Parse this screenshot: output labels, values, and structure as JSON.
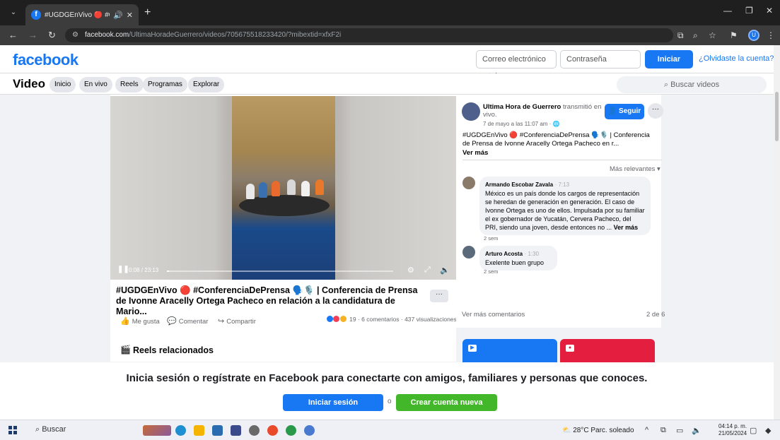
{
  "browser": {
    "tab_title": "#UGDGEnVivo 🔴 #Confere",
    "url_host": "facebook.com",
    "url_path": "/UltimaHoradeGuerrero/videos/705675518233420/?mibextid=xfxF2i"
  },
  "header": {
    "logo": "facebook",
    "email_placeholder": "Correo electrónico o tel",
    "password_placeholder": "Contraseña",
    "login_label": "Iniciar sesión",
    "forgot_label": "¿Olvidaste la cuenta?"
  },
  "video_nav": {
    "title": "Video",
    "tabs": [
      "Inicio",
      "En vivo",
      "Reels",
      "Programas",
      "Explorar"
    ],
    "search_placeholder": "Buscar videos"
  },
  "player": {
    "time": "0:08 / 23:13",
    "progress": 0.006
  },
  "post": {
    "title": "#UGDGEnVivo 🔴 #ConferenciaDePrensa 🗣️🎙️ | Conferencia de Prensa de Ivonne Aracelly Ortega Pacheco en relación a la candidatura de Mario...",
    "more_label": "···",
    "like_label": "Me gusta",
    "comment_label": "Comentar",
    "share_label": "Compartir",
    "stats": "19 · 6 comentarios · 437 visualizaciones"
  },
  "reels": {
    "title": "Reels relacionados"
  },
  "sidebar": {
    "page_name": "Ultima Hora de Guerrero",
    "page_action": "transmitió en vivo.",
    "date": "7 de mayo a las 11:07 am · 🌐",
    "follow_label": "Seguir",
    "dots_label": "···",
    "description": "#UGDGEnVivo 🔴 #ConferenciaDePrensa 🗣️🎙️ | Conferencia de Prensa de Ivonne Aracelly Ortega Pacheco en r...",
    "see_more": "Ver más",
    "sort_label": "Más relevantes ▾",
    "comments": [
      {
        "author": "Armando Escobar Zavala",
        "time": "· 7:13",
        "text": "México es un país donde los cargos de representación se heredan de generación en generación. El caso de Ivonne Ortega es uno de ellos. Impulsada por su familiar el ex gobernador de Yucatán, Cervera Pacheco, del PRI, siendo una joven, desde entonces no ...",
        "see_more": "Ver más",
        "age": "2 sem"
      },
      {
        "author": "Arturo Acosta",
        "time": "· 1:30",
        "text": "Exelente buen grupo",
        "age": "2 sem"
      }
    ],
    "more_comments": "Ver más comentarios",
    "count": "2 de 6"
  },
  "overlay": {
    "text": "Inicia sesión o regístrate en Facebook para conectarte con amigos, familiares y personas que conoces.",
    "login_label": "Iniciar sesión",
    "separator": "o",
    "create_label": "Crear cuenta nueva"
  },
  "taskbar": {
    "search_label": "Buscar",
    "weather": "28°C  Parc. soleado",
    "time": "04:14 p. m.",
    "date": "21/05/2024"
  },
  "colors": {
    "brand": "#1877f2",
    "create": "#42b72a"
  }
}
